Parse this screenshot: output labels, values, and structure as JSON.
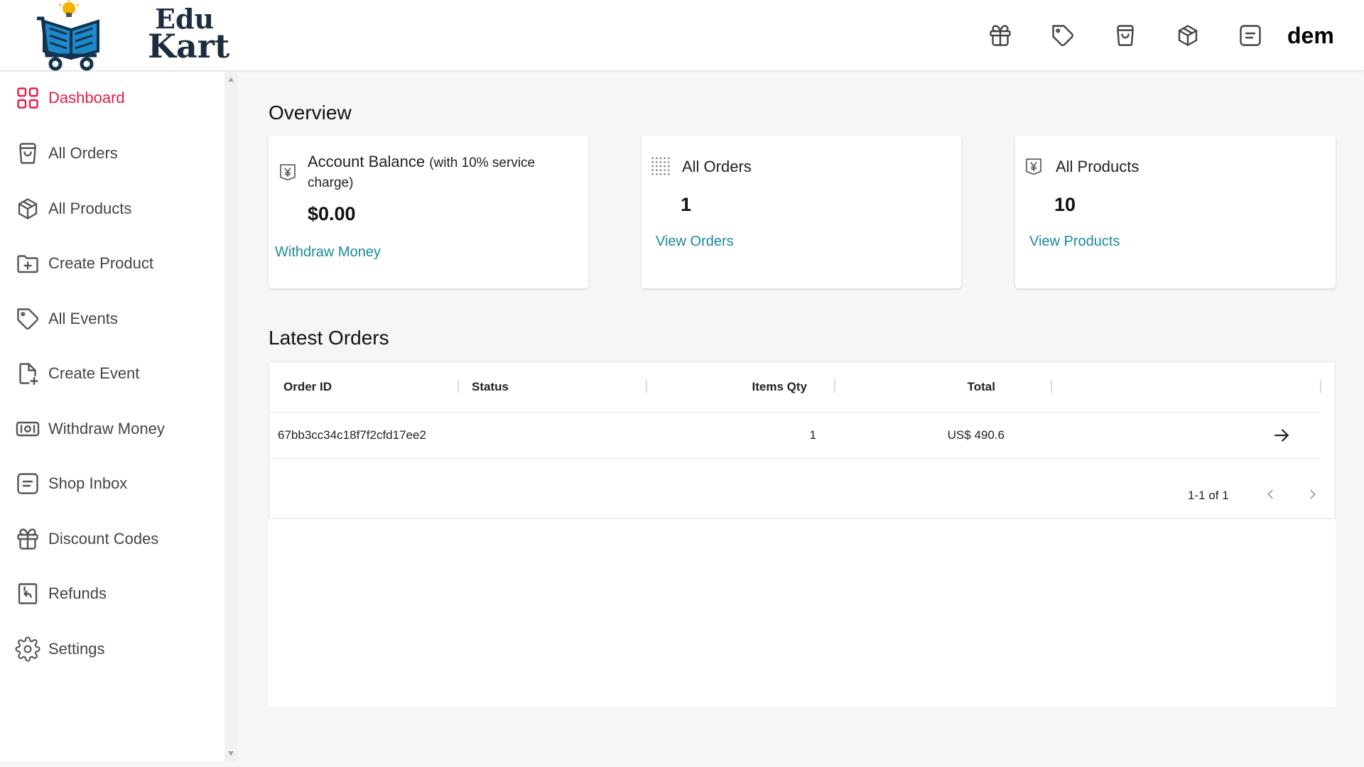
{
  "header": {
    "logo_line1": "Edu",
    "logo_line2": "Kart",
    "icons": [
      "gift-icon",
      "tag-icon",
      "shopping-bag-icon",
      "package-icon",
      "message-icon"
    ],
    "user_name": "dem"
  },
  "sidebar": {
    "active_color": "#e11d48",
    "items": [
      {
        "label": "Dashboard",
        "icon": "dashboard-grid-icon"
      },
      {
        "label": "All Orders",
        "icon": "shopping-bag-icon"
      },
      {
        "label": "All Products",
        "icon": "package-icon"
      },
      {
        "label": "Create Product",
        "icon": "folder-plus-icon"
      },
      {
        "label": "All Events",
        "icon": "tag-icon"
      },
      {
        "label": "Create Event",
        "icon": "file-plus-icon"
      },
      {
        "label": "Withdraw Money",
        "icon": "cash-icon"
      },
      {
        "label": "Shop Inbox",
        "icon": "message-icon"
      },
      {
        "label": "Discount Codes",
        "icon": "gift-icon"
      },
      {
        "label": "Refunds",
        "icon": "receipt-refund-icon"
      },
      {
        "label": "Settings",
        "icon": "gear-icon"
      }
    ]
  },
  "overview": {
    "title": "Overview",
    "balance": {
      "title": "Account Balance",
      "note": "(with 10% service charge)",
      "value": "$0.00",
      "link": "Withdraw Money",
      "icon": "money-bill-icon"
    },
    "orders": {
      "title": "All Orders",
      "value": "1",
      "link": "View Orders",
      "icon": "grid-dots-icon"
    },
    "products": {
      "title": "All Products",
      "value": "10",
      "link": "View Products",
      "icon": "money-bill-icon"
    }
  },
  "latest_orders": {
    "title": "Latest Orders",
    "columns": [
      "Order ID",
      "Status",
      "Items Qty",
      "Total"
    ],
    "rows": [
      {
        "order_id": "67bb3cc34c18f7f2cfd17ee2",
        "status": "",
        "items_qty": "1",
        "total": "US$ 490.6"
      }
    ],
    "pagination": "1-1 of 1"
  },
  "link_color": "#1a8a9a"
}
